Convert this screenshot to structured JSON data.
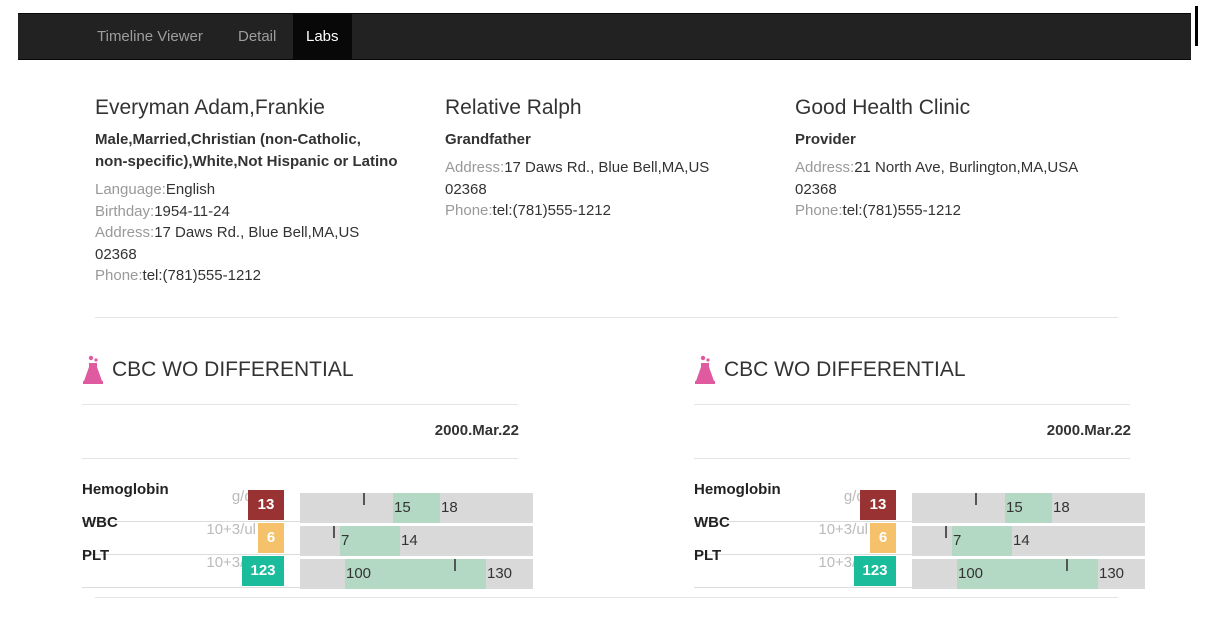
{
  "nav": {
    "items": [
      {
        "label": "Timeline Viewer"
      },
      {
        "label": "Detail"
      },
      {
        "label": "Labs"
      }
    ]
  },
  "patient": {
    "name": "Everyman Adam,Frankie",
    "subtitle_line1": "Male,Married,Christian (non-Catholic,",
    "subtitle_line2": "non-specific),White,Not Hispanic or Latino",
    "language_label": "Language:",
    "language": "English",
    "birthday_label": "Birthday:",
    "birthday": "1954-11-24",
    "address_label": "Address:",
    "address_line1": "17 Daws Rd., Blue Bell,MA,US",
    "address_line2": "02368",
    "phone_label": "Phone:",
    "phone": "tel:(781)555-1212"
  },
  "relative": {
    "name": "Relative Ralph",
    "relation": "Grandfather",
    "address_label": "Address:",
    "address_line1": "17 Daws Rd., Blue Bell,MA,US",
    "address_line2": "02368",
    "phone_label": "Phone:",
    "phone": "tel:(781)555-1212"
  },
  "provider": {
    "name": "Good Health Clinic",
    "role": "Provider",
    "address_label": "Address:",
    "address_line1": "21 North Ave, Burlington,MA,USA",
    "address_line2": "02368",
    "phone_label": "Phone:",
    "phone": "tel:(781)555-1212"
  },
  "panels": [
    {
      "title": "CBC WO DIFFERENTIAL",
      "date": "2000.Mar.22",
      "labs": [
        {
          "name": "Hemoglobin",
          "unit": "g/dl",
          "value": "13",
          "value_color": "#993333",
          "low": "15",
          "high": "18"
        },
        {
          "name": "WBC",
          "unit": "10+3/ul",
          "value": "6",
          "value_color": "#f5c26b",
          "low": "7",
          "high": "14"
        },
        {
          "name": "PLT",
          "unit": "10+3/ul",
          "value": "123",
          "value_color": "#1abc9c",
          "low": "100",
          "high": "130"
        }
      ]
    },
    {
      "title": "CBC WO DIFFERENTIAL",
      "date": "2000.Mar.22",
      "labs": [
        {
          "name": "Hemoglobin",
          "unit": "g/dl",
          "value": "13",
          "value_color": "#993333",
          "low": "15",
          "high": "18"
        },
        {
          "name": "WBC",
          "unit": "10+3/ul",
          "value": "6",
          "value_color": "#f5c26b",
          "low": "7",
          "high": "14"
        },
        {
          "name": "PLT",
          "unit": "10+3/ul",
          "value": "123",
          "value_color": "#1abc9c",
          "low": "100",
          "high": "130"
        }
      ]
    }
  ]
}
